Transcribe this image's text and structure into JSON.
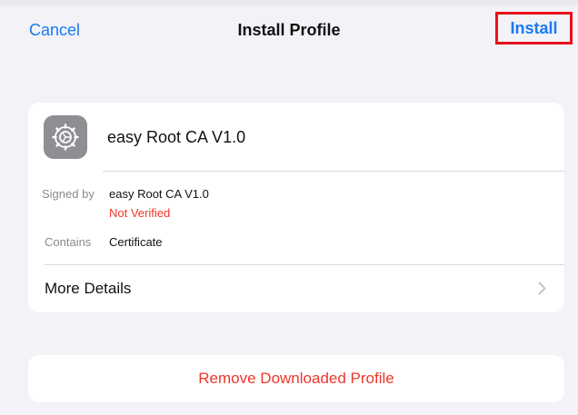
{
  "nav": {
    "cancel_label": "Cancel",
    "title": "Install Profile",
    "install_label": "Install",
    "highlight_color": "#e8121c"
  },
  "profile": {
    "icon": "settings-gear-icon",
    "name": "easy Root CA V1.0",
    "signed_by_label": "Signed by",
    "signed_by_value": "easy Root CA V1.0",
    "verification_status": "Not Verified",
    "contains_label": "Contains",
    "contains_value": "Certificate",
    "more_details_label": "More Details"
  },
  "actions": {
    "remove_label": "Remove Downloaded Profile"
  },
  "colors": {
    "accent": "#1a7bf2",
    "destructive": "#f0352b",
    "background": "#f2f2f7"
  }
}
